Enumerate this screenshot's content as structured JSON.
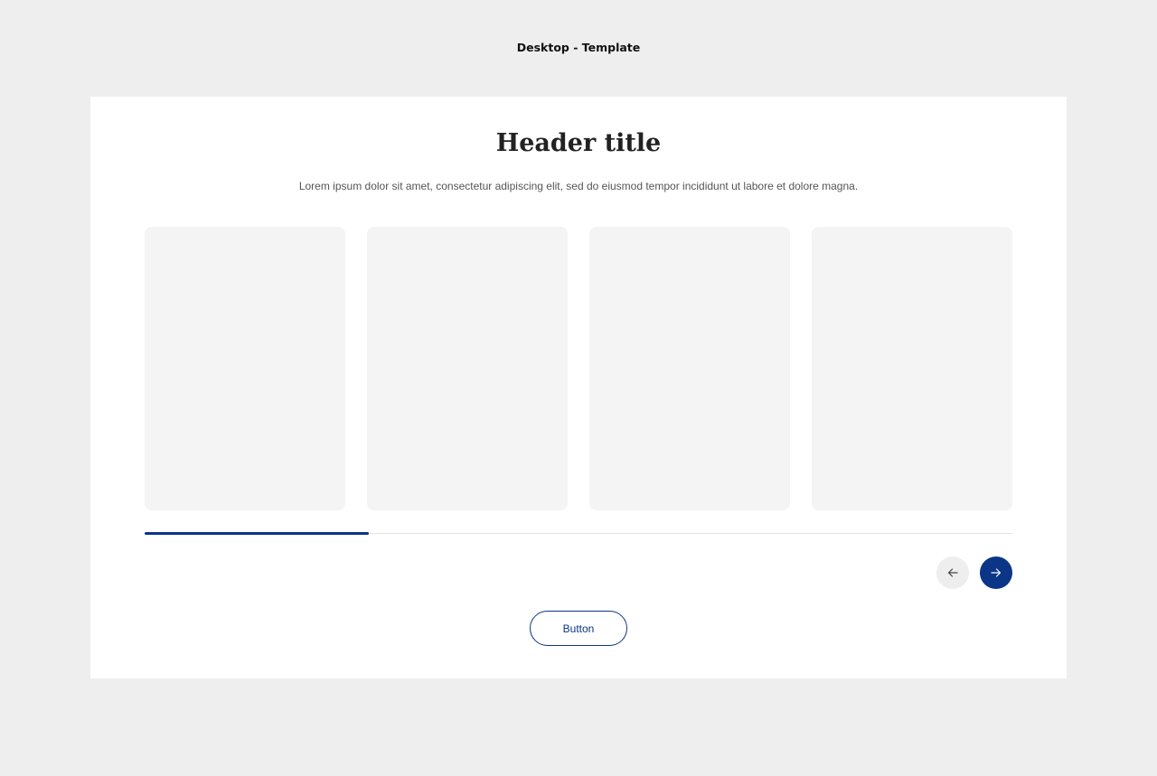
{
  "page_label": "Desktop - Template",
  "header": {
    "title": "Header title",
    "subtitle": "Lorem ipsum dolor sit amet, consectetur adipiscing elit, sed do eiusmod tempor incididunt ut labore et dolore magna."
  },
  "carousel": {
    "cards": [
      {},
      {},
      {},
      {}
    ],
    "progress_fraction": 0.258,
    "prev_icon": "arrow-left-icon",
    "next_icon": "arrow-right-icon"
  },
  "cta": {
    "label": "Button"
  },
  "colors": {
    "background": "#eeeeee",
    "card": "#f4f4f4",
    "accent": "#0b3587",
    "track": "#e2e2e2"
  }
}
